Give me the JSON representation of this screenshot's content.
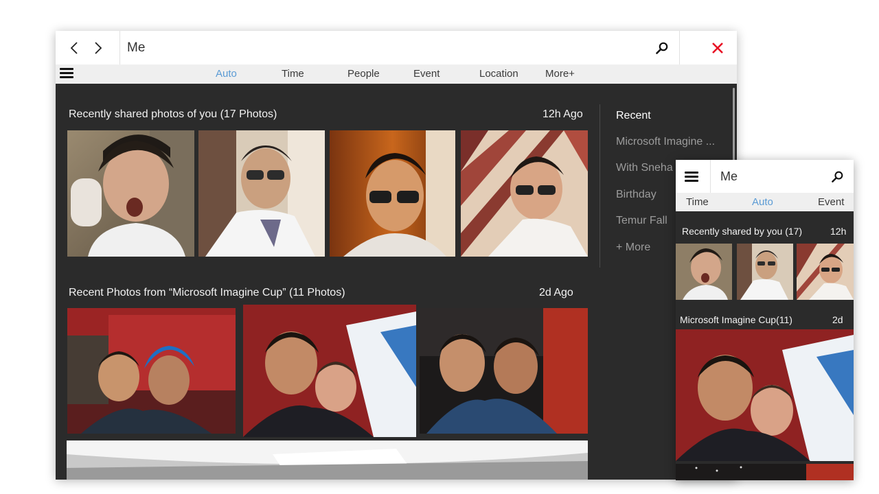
{
  "main": {
    "search": {
      "value": "Me"
    },
    "tabs": [
      {
        "label": "Auto",
        "active": true
      },
      {
        "label": "Time",
        "active": false
      },
      {
        "label": "People",
        "active": false
      },
      {
        "label": "Event",
        "active": false
      },
      {
        "label": "Location",
        "active": false
      },
      {
        "label": "More+",
        "active": false
      }
    ],
    "sections": [
      {
        "title": "Recently shared photos of you (17 Photos)",
        "time": "12h Ago"
      },
      {
        "title": "Recent Photos from “Microsoft Imagine Cup” (11 Photos)",
        "time": "2d Ago"
      }
    ],
    "recent": {
      "heading": "Recent",
      "items": [
        "Microsoft Imagine ...",
        "With Sneha",
        "Birthday",
        "Temur Fall",
        "+ More"
      ]
    }
  },
  "mini": {
    "search": {
      "value": "Me"
    },
    "tabs": [
      {
        "label": "Time",
        "active": false
      },
      {
        "label": "Auto",
        "active": true
      },
      {
        "label": "Event",
        "active": false
      }
    ],
    "sections": [
      {
        "title": "Recently shared by you (17)",
        "time": "12h"
      },
      {
        "title": "Microsoft Imagine Cup(11)",
        "time": "2d"
      }
    ]
  },
  "icons": {
    "back": "chevron-left-icon",
    "forward": "chevron-right-icon",
    "search": "search-icon",
    "close": "close-icon",
    "menu": "hamburger-menu-icon"
  },
  "colors": {
    "accent": "#5b9bd5",
    "close": "#e81123",
    "content_bg": "#2b2b2b",
    "tabbar_bg": "#efefef"
  }
}
